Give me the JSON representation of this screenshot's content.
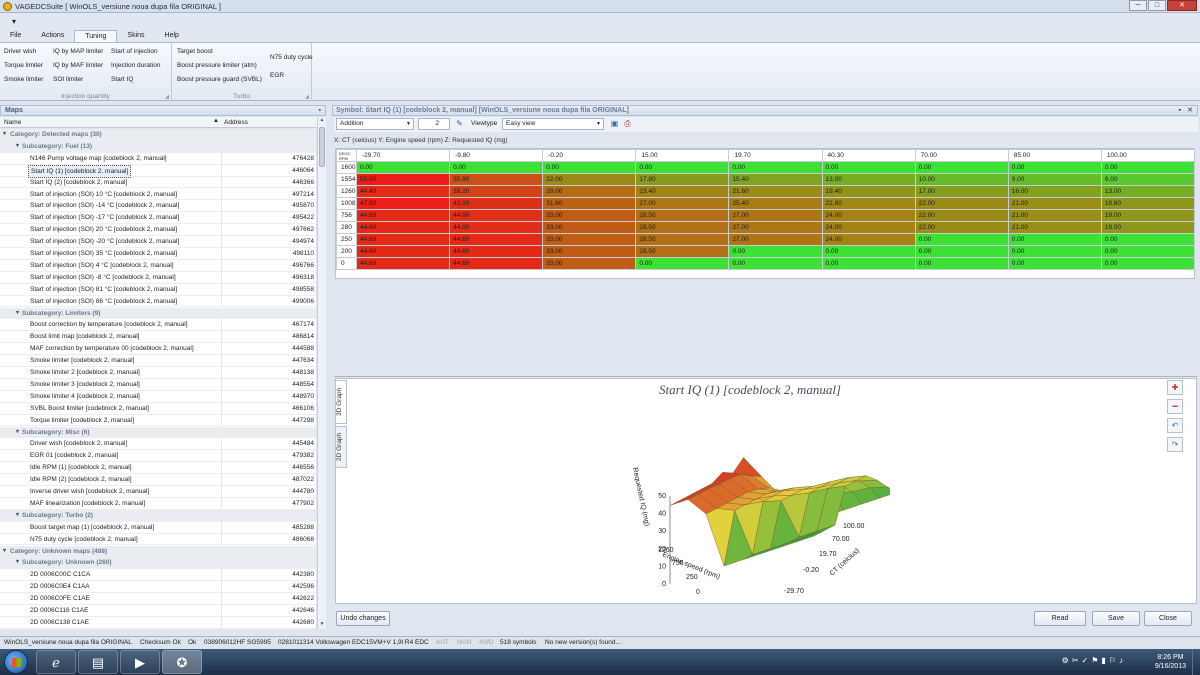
{
  "window": {
    "title": "VAGEDCSuite [ WinOLS_versiune noua dupa fila ORIGINAL ]",
    "min": "─",
    "max": "□",
    "close": "✕"
  },
  "qat": {
    "menu": "▾"
  },
  "ribbon": {
    "tabs": [
      "File",
      "Actions",
      "Tuning",
      "Skins",
      "Help"
    ],
    "active_tab": "Tuning",
    "injection_quantity": {
      "label": "Injection quantity",
      "buttons": [
        "Driver wish",
        "IQ by MAP limiter",
        "Start of injection",
        "Torque limiter",
        "IQ by MAF limiter",
        "Injection duration",
        "Smoke limiter",
        "SOI limiter",
        "Start IQ"
      ]
    },
    "turbo": {
      "label": "Turbo",
      "buttons": [
        "Target boost",
        "Boost pressure limiter (atm)",
        "Boost pressure guard (SVBL)",
        "N75 duty cycle",
        "EGR"
      ]
    }
  },
  "maps_panel": {
    "title": "Maps",
    "pin": "▪",
    "col_name": "Name",
    "col_address": "Address",
    "sort_arrow": "▲",
    "rows": [
      {
        "type": "cat",
        "label": "Category: Detected maps (30)"
      },
      {
        "type": "sub",
        "label": "Subcategory: Fuel (13)"
      },
      {
        "type": "item",
        "label": "N146 Pump voltage map [codeblock 2, manual]",
        "addr": "476428"
      },
      {
        "type": "item",
        "label": "Start IQ (1) [codeblock 2, manual]",
        "addr": "446064",
        "selected": true
      },
      {
        "type": "item",
        "label": "Start IQ (2) [codeblock 2, manual]",
        "addr": "446366"
      },
      {
        "type": "item",
        "label": "Start of injection (SOI) 10 °C [codeblock 2, manual]",
        "addr": "497214"
      },
      {
        "type": "item",
        "label": "Start of injection (SOI) -14 °C [codeblock 2, manual]",
        "addr": "495870"
      },
      {
        "type": "item",
        "label": "Start of injection (SOI) -17 °C [codeblock 2, manual]",
        "addr": "495422"
      },
      {
        "type": "item",
        "label": "Start of injection (SOI) 20 °C [codeblock 2, manual]",
        "addr": "497662"
      },
      {
        "type": "item",
        "label": "Start of injection (SOI) -20 °C [codeblock 2, manual]",
        "addr": "494974"
      },
      {
        "type": "item",
        "label": "Start of injection (SOI) 35 °C [codeblock 2, manual]",
        "addr": "498110"
      },
      {
        "type": "item",
        "label": "Start of injection (SOI) 4 °C [codeblock 2, manual]",
        "addr": "496766"
      },
      {
        "type": "item",
        "label": "Start of injection (SOI) -8 °C [codeblock 2, manual]",
        "addr": "496318"
      },
      {
        "type": "item",
        "label": "Start of injection (SOI) 81 °C [codeblock 2, manual]",
        "addr": "498558"
      },
      {
        "type": "item",
        "label": "Start of injection (SOI) 86 °C [codeblock 2, manual]",
        "addr": "499006"
      },
      {
        "type": "sub",
        "label": "Subcategory: Limiters (9)"
      },
      {
        "type": "item",
        "label": "Boost correction by temperature [codeblock 2, manual]",
        "addr": "467174"
      },
      {
        "type": "item",
        "label": "Boost limit map [codeblock 2, manual]",
        "addr": "486814"
      },
      {
        "type": "item",
        "label": "MAF correction by temperature 00 [codeblock 2, manual]",
        "addr": "444588"
      },
      {
        "type": "item",
        "label": "Smoke limiter [codeblock 2, manual]",
        "addr": "447634"
      },
      {
        "type": "item",
        "label": "Smoke limiter 2 [codeblock 2, manual]",
        "addr": "448138"
      },
      {
        "type": "item",
        "label": "Smoke limiter 3 [codeblock 2, manual]",
        "addr": "448554"
      },
      {
        "type": "item",
        "label": "Smoke limiter 4 [codeblock 2, manual]",
        "addr": "448970"
      },
      {
        "type": "item",
        "label": "SVBL Boost limiter [codeblock 2, manual]",
        "addr": "466106"
      },
      {
        "type": "item",
        "label": "Torque limiter [codeblock 2, manual]",
        "addr": "447298"
      },
      {
        "type": "sub",
        "label": "Subcategory: Misc (6)"
      },
      {
        "type": "item",
        "label": "Driver wish [codeblock 2, manual]",
        "addr": "445484"
      },
      {
        "type": "item",
        "label": "EGR 01 [codeblock 2, manual]",
        "addr": "479382"
      },
      {
        "type": "item",
        "label": "Idle RPM (1) [codeblock 2, manual]",
        "addr": "446556"
      },
      {
        "type": "item",
        "label": "Idle RPM (2) [codeblock 2, manual]",
        "addr": "487022"
      },
      {
        "type": "item",
        "label": "Inverse driver wish [codeblock 2, manual]",
        "addr": "444780"
      },
      {
        "type": "item",
        "label": "MAF linearization [codeblock 2, manual]",
        "addr": "477902"
      },
      {
        "type": "sub",
        "label": "Subcategory: Turbo (2)"
      },
      {
        "type": "item",
        "label": "Boost target map (1) [codeblock 2, manual]",
        "addr": "485288"
      },
      {
        "type": "item",
        "label": "N75 duty cycle [codeblock 2, manual]",
        "addr": "486068"
      },
      {
        "type": "cat",
        "label": "Category: Unknown maps (488)"
      },
      {
        "type": "sub",
        "label": "Subcategory: Unknown (260)"
      },
      {
        "type": "item",
        "label": "2D 0006C00C C1CA",
        "addr": "442380"
      },
      {
        "type": "item",
        "label": "2D 0006C0E4 C1AA",
        "addr": "442596"
      },
      {
        "type": "item",
        "label": "2D 0006C0FE C1AE",
        "addr": "442622"
      },
      {
        "type": "item",
        "label": "2D 0006C116 C1AE",
        "addr": "442646"
      },
      {
        "type": "item",
        "label": "2D 0006C138 C1AE",
        "addr": "442680"
      }
    ]
  },
  "symbol_panel": {
    "title": "Symbol: Start IQ (1) [codeblock 2, manual] [WinOLS_versiune noua dupa fila ORIGINAL]",
    "pin": "▪",
    "close": "✕",
    "toolbar": {
      "mode": "Addition",
      "amount": "2",
      "viewtype_label": "Viewtype",
      "viewtype": "Easy view"
    },
    "axis_info": "X: CT (celcius) Y: Engine speed (rpm) Z: Requested IQ (mg)",
    "corner_top": "DEGC",
    "corner_bottom": "RPM",
    "x_headers": [
      "-29.70",
      "-9.80",
      "-0.20",
      "15.00",
      "19.70",
      "40.30",
      "70.00",
      "85.00",
      "100.00"
    ],
    "rows": [
      {
        "rpm": "1600",
        "vals": [
          "0.00",
          "0.00",
          "0.00",
          "0.00",
          "0.00",
          "0.00",
          "0.00",
          "0.00",
          "0.00"
        ]
      },
      {
        "rpm": "1554",
        "vals": [
          "50.00",
          "35.80",
          "22.00",
          "17.80",
          "15.40",
          "13.00",
          "10.00",
          "9.00",
          "6.00"
        ]
      },
      {
        "rpm": "1260",
        "vals": [
          "44.40",
          "39.20",
          "29.00",
          "23.40",
          "21.60",
          "19.40",
          "17.00",
          "16.00",
          "13.00"
        ]
      },
      {
        "rpm": "1008",
        "vals": [
          "47.80",
          "43.20",
          "31.60",
          "27.00",
          "25.40",
          "22.80",
          "22.00",
          "21.00",
          "18.60"
        ]
      },
      {
        "rpm": "756",
        "vals": [
          "44.60",
          "44.00",
          "33.00",
          "28.50",
          "27.00",
          "24.00",
          "22.00",
          "21.00",
          "19.00"
        ]
      },
      {
        "rpm": "280",
        "vals": [
          "44.60",
          "44.00",
          "33.00",
          "28.50",
          "27.00",
          "24.00",
          "22.00",
          "21.00",
          "19.00"
        ]
      },
      {
        "rpm": "250",
        "vals": [
          "44.60",
          "44.60",
          "33.00",
          "28.50",
          "27.00",
          "24.00",
          "0.00",
          "0.00",
          "0.00"
        ]
      },
      {
        "rpm": "200",
        "vals": [
          "44.60",
          "44.60",
          "33.00",
          "28.50",
          "0.00",
          "0.00",
          "0.00",
          "0.00",
          "0.00"
        ]
      },
      {
        "rpm": "0",
        "vals": [
          "44.60",
          "44.60",
          "33.00",
          "0.00",
          "0.00",
          "0.00",
          "0.00",
          "0.00",
          "0.00"
        ]
      }
    ],
    "graph": {
      "tab_3d": "3D Graph",
      "tab_2d": "2D Graph",
      "title": "Start IQ (1) [codeblock 2, manual]",
      "z_label": "Requested IQ (mg)",
      "y_label": "Engine speed (rpm)",
      "x_label": "CT (celcius)",
      "z_ticks": [
        "50",
        "40",
        "30",
        "20",
        "10",
        "0"
      ],
      "y_ticks": [
        "1260",
        "756",
        "250",
        "0"
      ],
      "x_ticks": [
        "100.00",
        "70.00",
        "19.70",
        "-0.20",
        "-29.70"
      ]
    },
    "buttons": {
      "undo": "Undo changes",
      "read": "Read",
      "save": "Save",
      "close": "Close"
    }
  },
  "status": {
    "file": "WinOLS_versiune noua dupa fila ORIGINAL",
    "checksum": "Checksum Ok",
    "ok": "Ok",
    "partno": "038906012HF SG5995",
    "ecu": "0281011314 Volkswagen EDC15VM+V 1,9l R4 EDC",
    "aut": "AUT",
    "man": "MAN",
    "fwd": "4WD",
    "symbols": "518 symbols",
    "version": "No new version(s) found..."
  },
  "taskbar": {
    "time": "8:26 PM",
    "date": "9/16/2013",
    "tray_icons": "⚙✂✓⚑▮⚐♪"
  },
  "colors": {
    "ribbon_bg": "#e3eaf4",
    "panel_header": "#d3dfee",
    "taskbar": "#1c2f46",
    "cell_green": "#3de034",
    "cell_red": "#ee1c18"
  }
}
